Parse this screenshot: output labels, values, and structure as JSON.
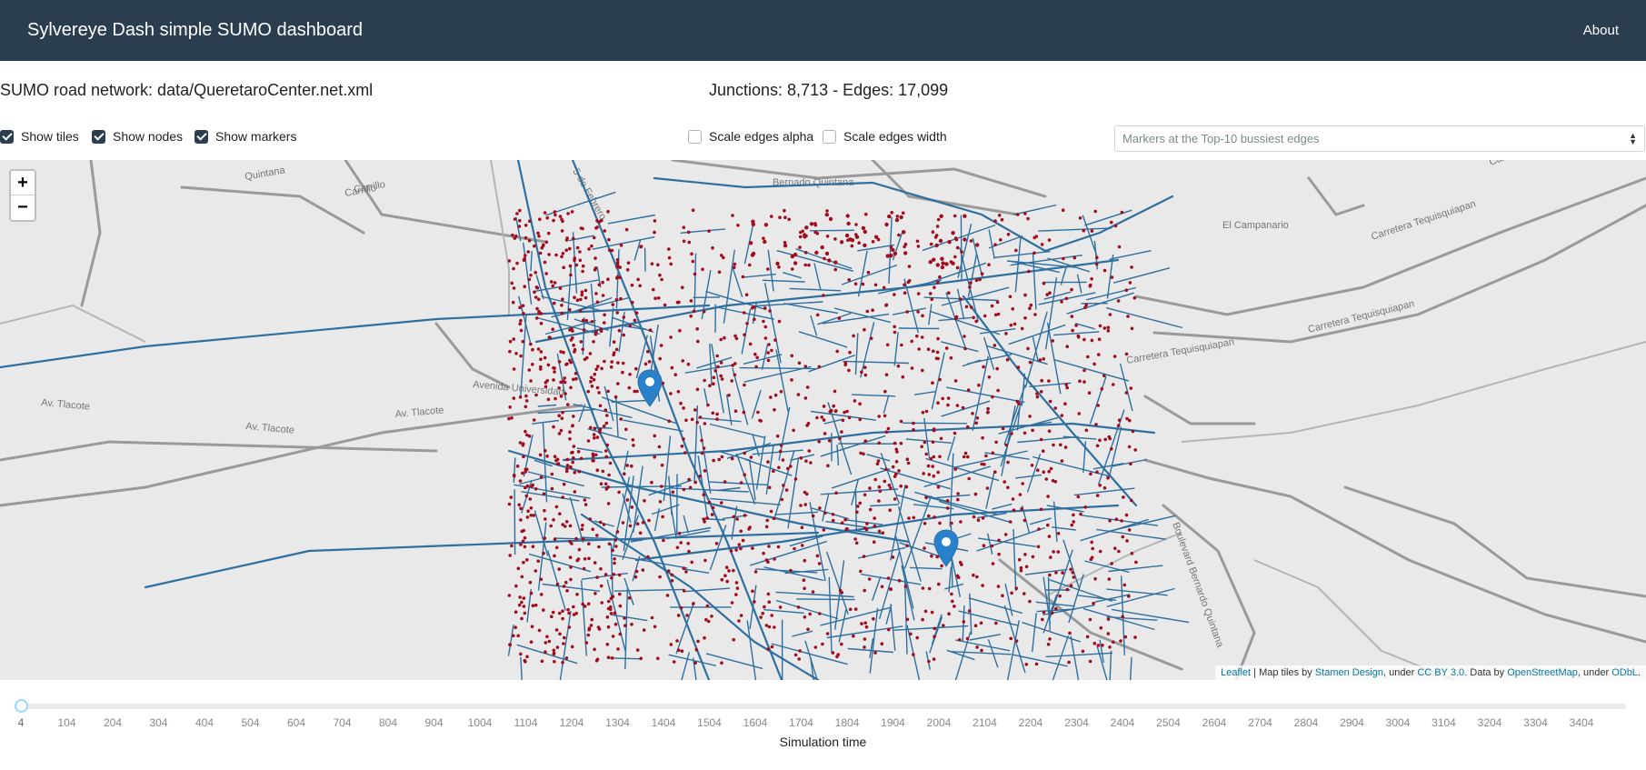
{
  "navbar": {
    "brand": "Sylvereye Dash simple SUMO dashboard",
    "about": "About"
  },
  "info": {
    "network": "SUMO road network: data/QueretaroCenter.net.xml",
    "stats": "Junctions: 8,713 - Edges: 17,099"
  },
  "controls": {
    "show_tiles": {
      "label": "Show tiles",
      "checked": true
    },
    "show_nodes": {
      "label": "Show nodes",
      "checked": true
    },
    "show_markers": {
      "label": "Show markers",
      "checked": true
    },
    "scale_alpha": {
      "label": "Scale edges alpha",
      "checked": false
    },
    "scale_width": {
      "label": "Scale edges width",
      "checked": false
    },
    "markers_select": "Markers at the Top-10 bussiest edges"
  },
  "map": {
    "zoom_in": "+",
    "zoom_out": "−",
    "attribution": {
      "leaflet": "Leaflet",
      "sep1": " | Map tiles by ",
      "stamen": "Stamen Design",
      "sep2": ", under ",
      "ccby": "CC BY 3.0",
      "sep3": ". Data by ",
      "osm": "OpenStreetMap",
      "sep4": ", under ",
      "odbl": "ODbL",
      "end": "."
    },
    "place_labels": [
      "Quintana",
      "Carrillo",
      "Carrillo",
      "Bernado Quintana",
      "El Campanario",
      "Carretera Tequisquiapan",
      "Carretera Tequisquiapan",
      "Carretera Tequisquiapan",
      "Carretera Tequisquiapan",
      "Av. Tlacote",
      "Av. Tlacote",
      "Av. Tlacote",
      "Avenida Universidad",
      "Boulevard Bernardo Quintana",
      "5 de Febrero"
    ],
    "colors": {
      "edges": "#2f6f9f",
      "nodes": "#a00d1e",
      "roads": "#9a9a9a",
      "marker": "#2a81cb"
    }
  },
  "slider": {
    "ticks": [
      "4",
      "104",
      "204",
      "304",
      "404",
      "504",
      "604",
      "704",
      "804",
      "904",
      "1004",
      "1104",
      "1204",
      "1304",
      "1404",
      "1504",
      "1604",
      "1704",
      "1804",
      "1904",
      "2004",
      "2104",
      "2204",
      "2304",
      "2404",
      "2504",
      "2604",
      "2704",
      "2804",
      "2904",
      "3004",
      "3104",
      "3204",
      "3304",
      "3404"
    ],
    "value": 4,
    "label": "Simulation time"
  }
}
